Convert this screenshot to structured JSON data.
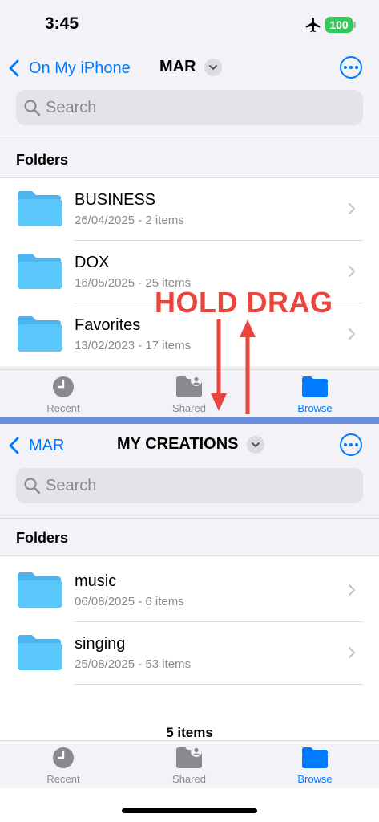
{
  "status_bar": {
    "time": "3:45",
    "battery": "100"
  },
  "top_pane": {
    "back_label": "On My iPhone",
    "title": "MAR",
    "search_placeholder": "Search",
    "section_header": "Folders",
    "folders": [
      {
        "name": "BUSINESS",
        "meta": "26/04/2025 - 2 items"
      },
      {
        "name": "DOX",
        "meta": "16/05/2025 - 25 items"
      },
      {
        "name": "Favorites",
        "meta": "13/02/2023 - 17 items"
      }
    ],
    "tabs": [
      {
        "label": "Recent",
        "icon": "clock-icon",
        "active": false
      },
      {
        "label": "Shared",
        "icon": "shared-folder-icon",
        "active": false
      },
      {
        "label": "Browse",
        "icon": "folder-icon",
        "active": true
      }
    ]
  },
  "bottom_pane": {
    "back_label": "MAR",
    "title": "MY CREATIONS",
    "search_placeholder": "Search",
    "section_header": "Folders",
    "folders": [
      {
        "name": "music",
        "meta": "06/08/2025 - 6 items"
      },
      {
        "name": "singing",
        "meta": "25/08/2025 - 53 items"
      }
    ],
    "item_count": "5 items",
    "tabs": [
      {
        "label": "Recent",
        "icon": "clock-icon",
        "active": false
      },
      {
        "label": "Shared",
        "icon": "shared-folder-icon",
        "active": false
      },
      {
        "label": "Browse",
        "icon": "folder-icon",
        "active": true
      }
    ]
  },
  "annotation": {
    "text": "HOLD DRAG",
    "color": "#e8453c"
  },
  "colors": {
    "accent": "#007aff",
    "folder": "#5ac8fa",
    "divider": "#6b8fe0"
  }
}
